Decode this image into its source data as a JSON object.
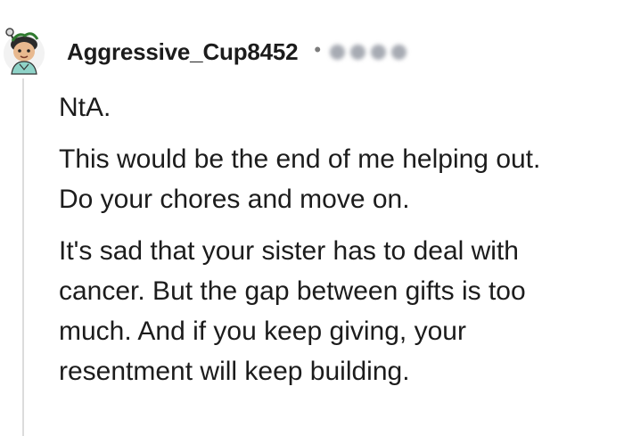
{
  "comment": {
    "username": "Aggressive_Cup8452",
    "separator": "•",
    "paragraphs": [
      {
        "lines": [
          "NtA."
        ]
      },
      {
        "lines": [
          "This would be the end of me helping out.",
          "Do your chores and move on."
        ]
      },
      {
        "lines": [
          "It's sad that your sister has to deal with",
          "cancer. But the gap between gifts is too",
          "much. And if you keep giving, your",
          "resentment will keep building."
        ]
      }
    ]
  },
  "colors": {
    "text": "#1c1c1c",
    "meta": "#7c7c7c",
    "thread_line": "#dcdcdc",
    "avatar_skin": "#e8b98f",
    "avatar_shirt": "#8fd3c8"
  },
  "icons": {
    "avatar": "user-avatar-icon",
    "redacted": "blurred-flair-icon"
  }
}
